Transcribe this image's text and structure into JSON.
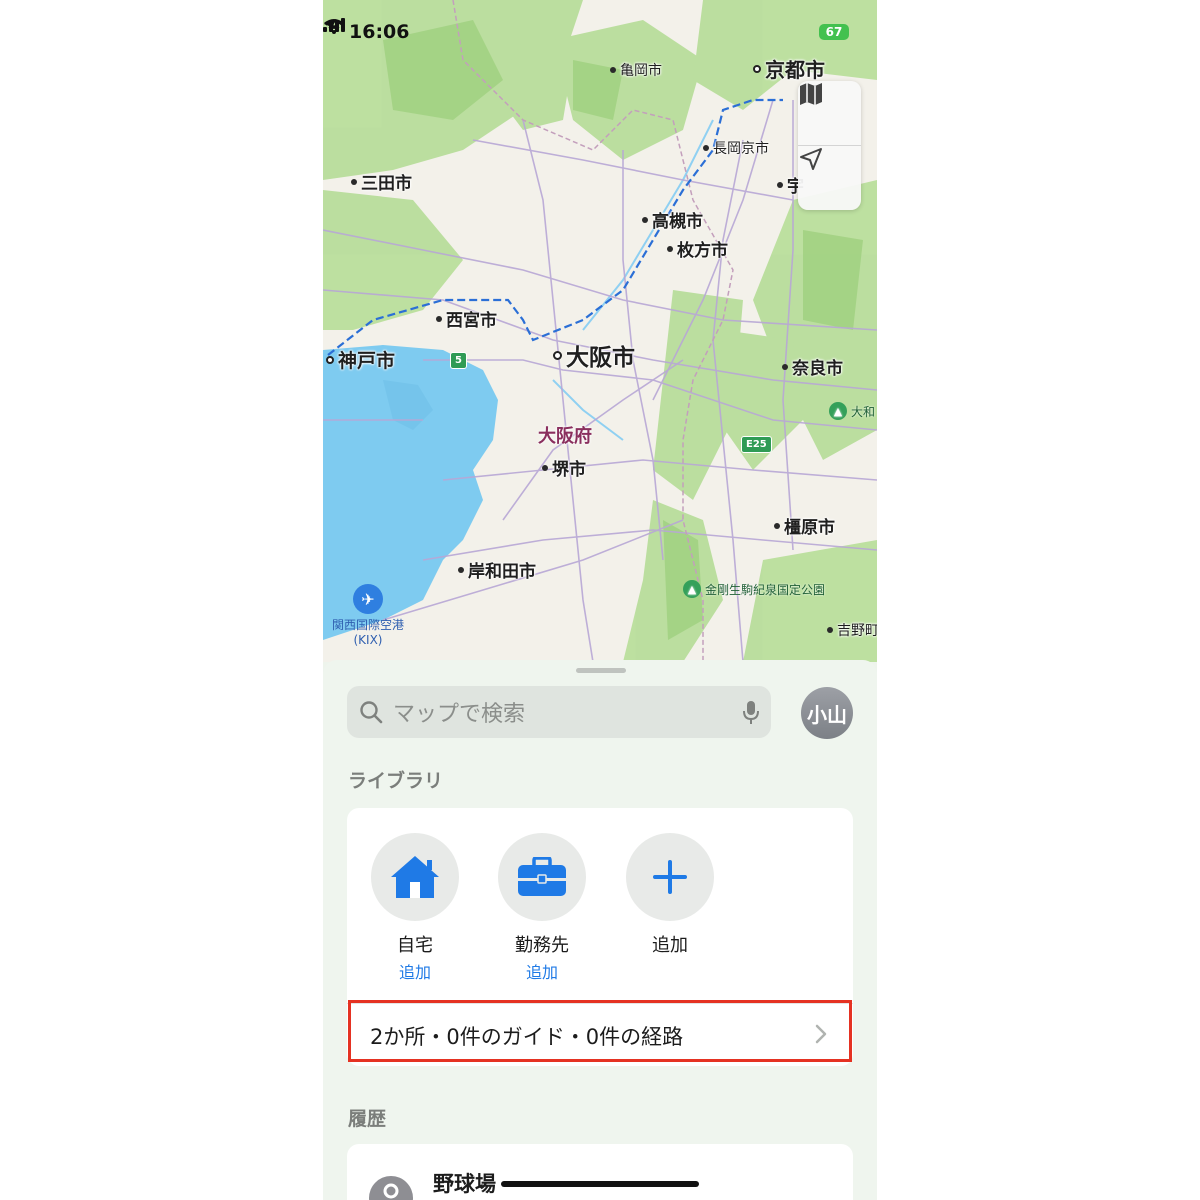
{
  "status_bar": {
    "time": "16:06",
    "battery": "67"
  },
  "map": {
    "cities": [
      {
        "name": "亀岡市",
        "size": "small"
      },
      {
        "name": "京都市",
        "size": "medium"
      },
      {
        "name": "長岡京市",
        "size": "small"
      },
      {
        "name": "宇",
        "size": "medium"
      },
      {
        "name": "三田市",
        "size": "medium"
      },
      {
        "name": "高槻市",
        "size": "medium"
      },
      {
        "name": "枚方市",
        "size": "medium"
      },
      {
        "name": "西宮市",
        "size": "medium"
      },
      {
        "name": "神戸市",
        "size": "medium"
      },
      {
        "name": "大阪市",
        "size": "large"
      },
      {
        "name": "奈良市",
        "size": "medium"
      },
      {
        "name": "堺市",
        "size": "medium"
      },
      {
        "name": "橿原市",
        "size": "medium"
      },
      {
        "name": "岸和田市",
        "size": "medium"
      },
      {
        "name": "吉野町",
        "size": "small"
      }
    ],
    "prefecture": "大阪府",
    "park_label": "金剛生駒紀泉国定公園",
    "park_partial": "大和",
    "airport": {
      "line1": "関西国際空港",
      "line2": "(KIX)"
    },
    "route_shields": [
      "5",
      "E25"
    ],
    "icons": {
      "map_mode": "map-icon",
      "locate": "location-arrow-icon"
    }
  },
  "sheet": {
    "search_placeholder": "マップで検索",
    "avatar_initials": "小山",
    "library_title": "ライブラリ",
    "library_items": [
      {
        "label": "自宅",
        "action": "追加",
        "icon": "house-icon"
      },
      {
        "label": "勤務先",
        "action": "追加",
        "icon": "briefcase-icon"
      },
      {
        "label": "追加",
        "action": "",
        "icon": "plus-icon"
      }
    ],
    "summary": "2か所・0件のガイド・0件の経路",
    "history_title": "履歴",
    "history_items": [
      {
        "name": "野球場",
        "icon": "pin-icon"
      }
    ]
  },
  "colors": {
    "accent": "#1f7ae6",
    "highlight_border": "#e53222",
    "water": "#7ecbf0",
    "land": "#f3f1ea",
    "green": "#a9d68a"
  }
}
